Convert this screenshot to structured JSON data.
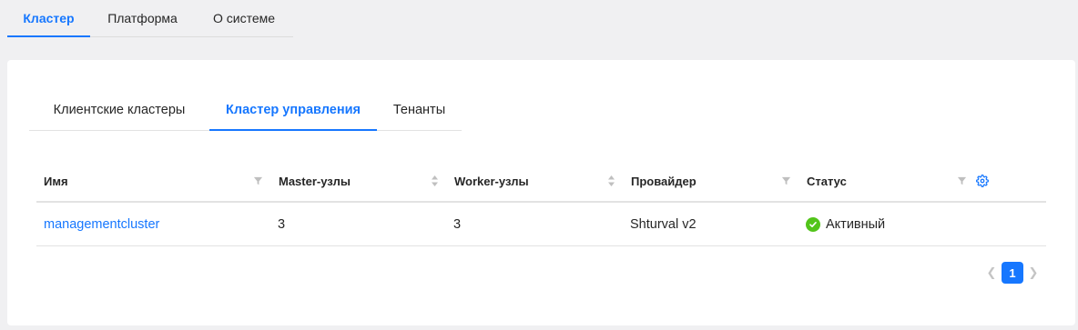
{
  "top_tabs": [
    {
      "label": "Кластер",
      "active": true
    },
    {
      "label": "Платформа",
      "active": false
    },
    {
      "label": "О системе",
      "active": false
    }
  ],
  "sub_tabs": [
    {
      "label": "Клиентские кластеры",
      "active": false
    },
    {
      "label": "Кластер управления",
      "active": true
    },
    {
      "label": "Тенанты",
      "active": false
    }
  ],
  "table": {
    "columns": [
      {
        "label": "Имя",
        "control": "filter-icon"
      },
      {
        "label": "Master-узлы",
        "control": "sort-icon"
      },
      {
        "label": "Worker-узлы",
        "control": "sort-icon"
      },
      {
        "label": "Провайдер",
        "control": "filter-icon"
      },
      {
        "label": "Статус",
        "control": "filter-icon"
      },
      {
        "label": "",
        "control": "settings-gear-icon"
      }
    ],
    "rows": [
      {
        "name": "managementcluster",
        "master_nodes": "3",
        "worker_nodes": "3",
        "provider": "Shturval v2",
        "status": "Активный",
        "status_icon": "check-circle-icon"
      }
    ]
  },
  "pagination": {
    "current_page": "1"
  },
  "colors": {
    "accent": "#1677ff",
    "status_active": "#52c41a",
    "background": "#f0f0f2"
  }
}
